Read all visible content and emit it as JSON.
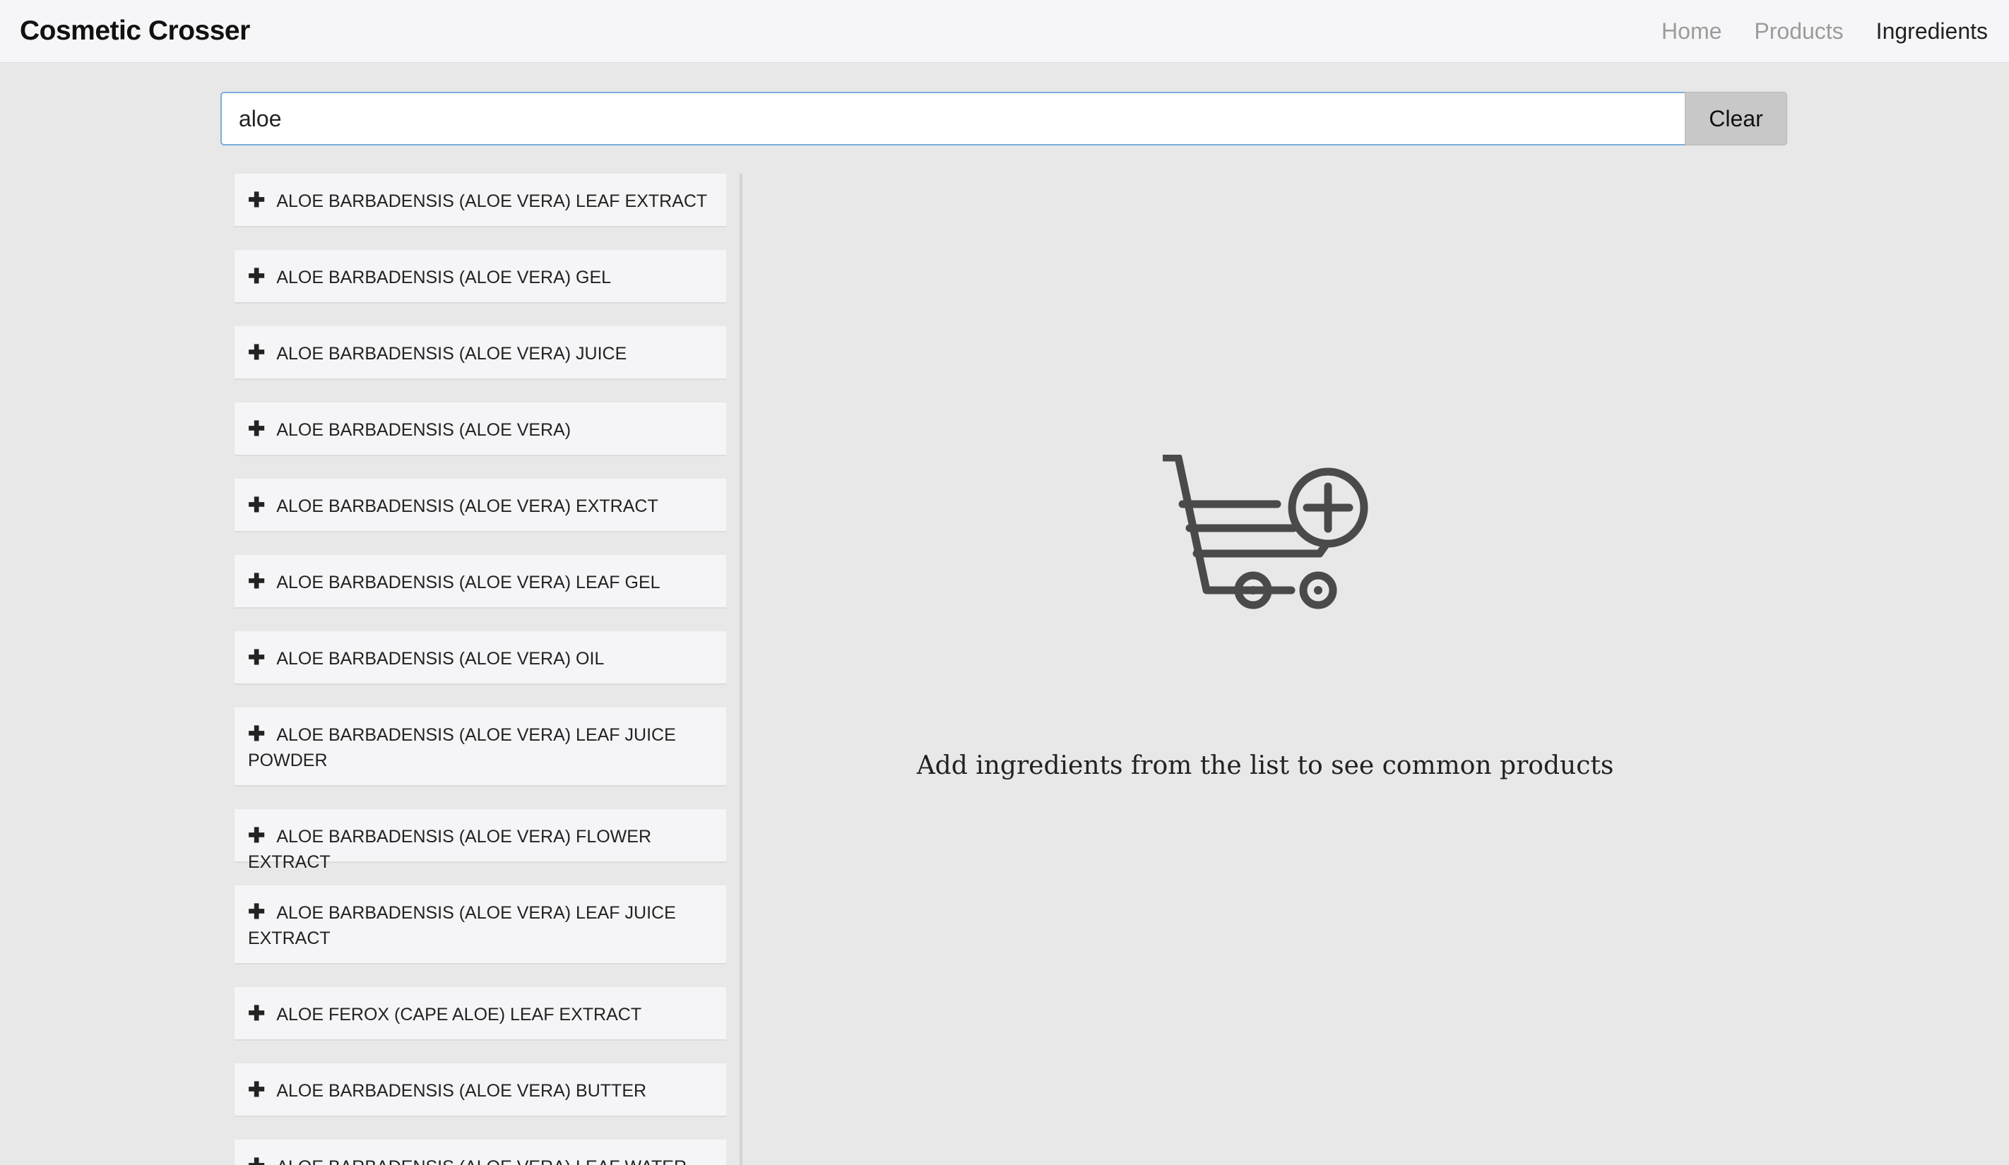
{
  "navbar": {
    "brand": "Cosmetic Crosser",
    "links": [
      "Home",
      "Products",
      "Ingredients"
    ],
    "active": "Ingredients"
  },
  "search": {
    "value": "aloe",
    "clear_label": "Clear"
  },
  "ingredients": [
    "ALOE BARBADENSIS (ALOE VERA) LEAF EXTRACT",
    "ALOE BARBADENSIS (ALOE VERA) GEL",
    "ALOE BARBADENSIS (ALOE VERA) JUICE",
    "ALOE BARBADENSIS (ALOE VERA)",
    "ALOE BARBADENSIS (ALOE VERA) EXTRACT",
    "ALOE BARBADENSIS (ALOE VERA) LEAF GEL",
    "ALOE BARBADENSIS (ALOE VERA) OIL",
    "ALOE BARBADENSIS (ALOE VERA) LEAF JUICE POWDER",
    "ALOE BARBADENSIS (ALOE VERA) FLOWER EXTRACT",
    "ALOE BARBADENSIS (ALOE VERA) LEAF JUICE EXTRACT",
    "ALOE FEROX (CAPE ALOE) LEAF EXTRACT",
    "ALOE BARBADENSIS (ALOE VERA) BUTTER",
    "ALOE BARBADENSIS (ALOE VERA) LEAF WATER"
  ],
  "item_icon": "plus-icon",
  "empty_state": {
    "icon": "cart-add-icon",
    "message": "Add ingredients from the list to see common products"
  },
  "colors": {
    "background": "#e8e8e8",
    "navbar": "#f6f6f8",
    "input_focus_border": "#7aaedc",
    "clear_button": "#c8c8c8",
    "list_item": "#f5f5f7",
    "icon": "#4a4a4a"
  }
}
